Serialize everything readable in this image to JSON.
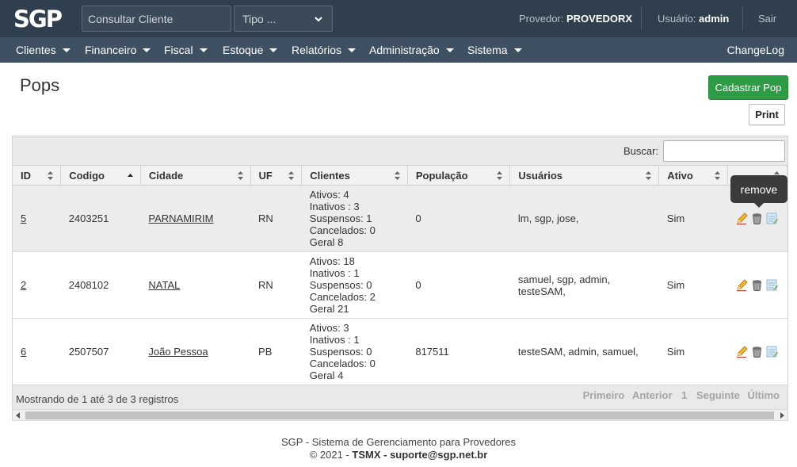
{
  "header": {
    "search": {
      "placeholder": "Consultar Cliente"
    },
    "type_select": {
      "value": "Tipo ..."
    },
    "provider_label": "Provedor:",
    "provider_name": "PROVEDORX",
    "user_label": "Usuário:",
    "user_name": "admin",
    "logout": "Sair"
  },
  "menu": {
    "items": [
      {
        "label": "Clientes"
      },
      {
        "label": "Financeiro"
      },
      {
        "label": "Fiscal"
      },
      {
        "label": "Estoque"
      },
      {
        "label": "Relatórios"
      },
      {
        "label": "Administração"
      },
      {
        "label": "Sistema"
      }
    ],
    "changelog": "ChangeLog"
  },
  "page": {
    "title": "Pops",
    "add_button": "Cadastrar Pop",
    "print_button": "Print"
  },
  "table": {
    "search_label": "Buscar:",
    "columns": [
      "ID",
      "Codigo",
      "Cidade",
      "UF",
      "Clientes",
      "População",
      "Usuários",
      "Ativo",
      ""
    ],
    "rows": [
      {
        "id": "5",
        "codigo": "2403251",
        "cidade": "PARNAMIRIM",
        "uf": "RN",
        "clientes": [
          "Ativos: 4",
          "Inativos : 3",
          "Suspensos: 1",
          "Cancelados: 0",
          "Geral 8"
        ],
        "populacao": "0",
        "usuarios": "lm, sgp, jose,",
        "ativo": "Sim"
      },
      {
        "id": "2",
        "codigo": "2408102",
        "cidade": "NATAL",
        "uf": "RN",
        "clientes": [
          "Ativos: 18",
          "Inativos : 1",
          "Suspensos: 0",
          "Cancelados: 2",
          "Geral 21"
        ],
        "populacao": "0",
        "usuarios": "samuel, sgp, admin, testeSAM,",
        "ativo": "Sim"
      },
      {
        "id": "6",
        "codigo": "2507507",
        "cidade": "João Pessoa",
        "uf": "PB",
        "clientes": [
          "Ativos: 3",
          "Inativos : 1",
          "Suspensos: 0",
          "Cancelados: 0",
          "Geral 4"
        ],
        "populacao": "817511",
        "usuarios": "testeSAM, admin, samuel,",
        "ativo": "Sim"
      }
    ],
    "info": "Mostrando de 1 até 3 de 3 registros",
    "paging": {
      "first": "Primeiro",
      "prev": "Anterior",
      "current": "1",
      "next": "Seguinte",
      "last": "Último"
    },
    "tooltip": "remove"
  },
  "footer": {
    "line1": "SGP - Sistema de Gerenciamento para Provedores",
    "copyright": "© 2021 -",
    "company": "TSMX - suporte@sgp.net.br"
  }
}
